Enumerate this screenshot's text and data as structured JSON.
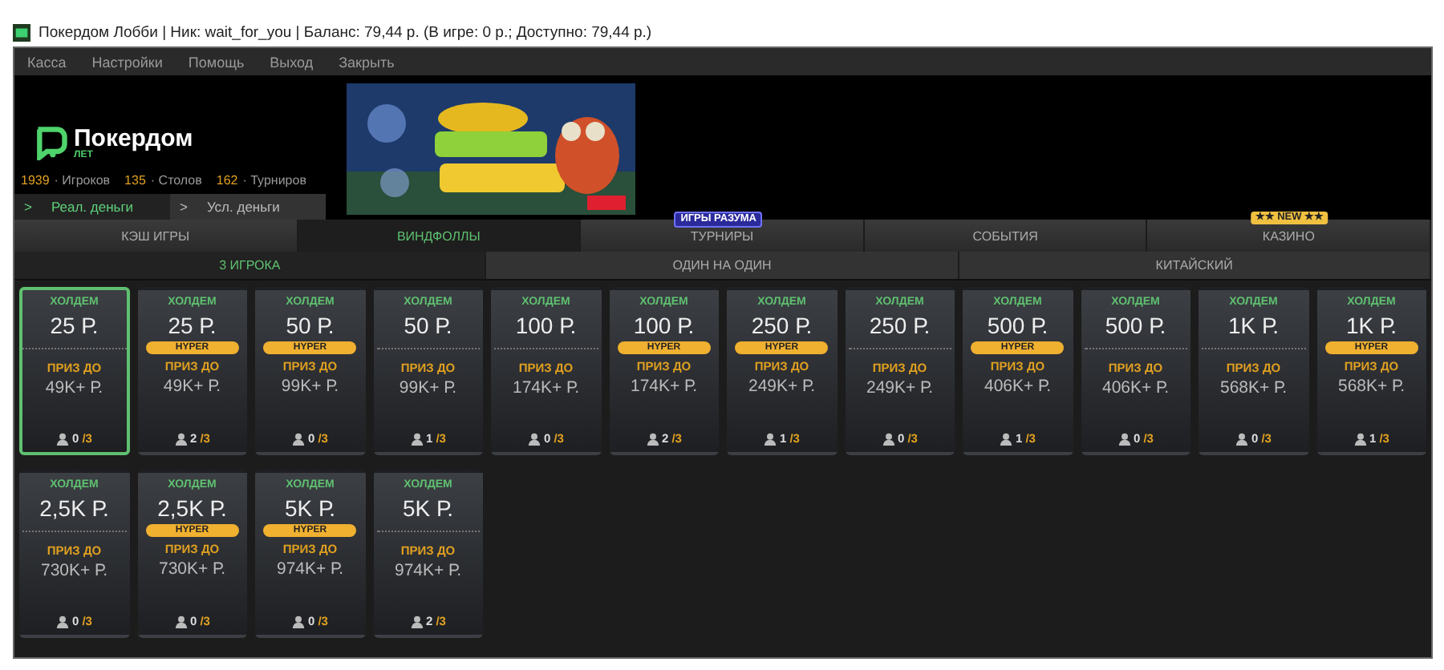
{
  "window": {
    "title": "Покердом Лобби | Ник: wait_for_you | Баланс: 79,44 р. (В игре: 0 р.; Доступно: 79,44 р.)"
  },
  "menu": [
    "Касса",
    "Настройки",
    "Помощь",
    "Выход",
    "Закрыть"
  ],
  "header": {
    "logo": {
      "name": "Покердом",
      "sub": "ЛЕТ"
    },
    "stats": [
      {
        "count": "1939",
        "label": "· Игроков"
      },
      {
        "count": "135",
        "label": "· Столов"
      },
      {
        "count": "162",
        "label": "· Турниров"
      }
    ],
    "money_tabs": [
      {
        "arrow": ">",
        "label": "Реал. деньги",
        "selected": true
      },
      {
        "arrow": ">",
        "label": "Усл. деньги",
        "selected": false
      }
    ]
  },
  "tabs": [
    {
      "label": "КЭШ ИГРЫ",
      "selected": false
    },
    {
      "label": "ВИНДФОЛЛЫ",
      "selected": true
    },
    {
      "label": "ТУРНИРЫ",
      "selected": false,
      "badge": "ИГРЫ РАЗУМА",
      "kind": "mind"
    },
    {
      "label": "СОБЫТИЯ",
      "selected": false
    },
    {
      "label": "КАЗИНО",
      "selected": false,
      "badge": "★★ NEW ★★",
      "kind": "new"
    }
  ],
  "subtabs": [
    {
      "label": "3 ИГРОКА",
      "selected": true
    },
    {
      "label": "ОДИН НА ОДИН",
      "selected": false
    },
    {
      "label": "КИТАЙСКИЙ",
      "selected": false
    }
  ],
  "cards": [
    {
      "game": "ХОЛДЕМ",
      "stake": "25 Р.",
      "prize_label": "ПРИЗ ДО",
      "prize": "49K+ Р.",
      "seated": "0",
      "max": "/3",
      "selected": true
    },
    {
      "game": "ХОЛДЕМ",
      "stake": "25 Р.",
      "badge": "HYPER",
      "prize_label": "ПРИЗ ДО",
      "prize": "49K+ Р.",
      "seated": "2",
      "max": "/3",
      "selected": false
    },
    {
      "game": "ХОЛДЕМ",
      "stake": "50 Р.",
      "badge": "HYPER",
      "prize_label": "ПРИЗ ДО",
      "prize": "99K+ Р.",
      "seated": "0",
      "max": "/3",
      "selected": false
    },
    {
      "game": "ХОЛДЕМ",
      "stake": "50 Р.",
      "prize_label": "ПРИЗ ДО",
      "prize": "99K+ Р.",
      "seated": "1",
      "max": "/3",
      "selected": false
    },
    {
      "game": "ХОЛДЕМ",
      "stake": "100 Р.",
      "prize_label": "ПРИЗ ДО",
      "prize": "174K+ Р.",
      "seated": "0",
      "max": "/3",
      "selected": false
    },
    {
      "game": "ХОЛДЕМ",
      "stake": "100 Р.",
      "badge": "HYPER",
      "prize_label": "ПРИЗ ДО",
      "prize": "174K+ Р.",
      "seated": "2",
      "max": "/3",
      "selected": false
    },
    {
      "game": "ХОЛДЕМ",
      "stake": "250 Р.",
      "badge": "HYPER",
      "prize_label": "ПРИЗ ДО",
      "prize": "249K+ Р.",
      "seated": "1",
      "max": "/3",
      "selected": false
    },
    {
      "game": "ХОЛДЕМ",
      "stake": "250 Р.",
      "prize_label": "ПРИЗ ДО",
      "prize": "249K+ Р.",
      "seated": "0",
      "max": "/3",
      "selected": false
    },
    {
      "game": "ХОЛДЕМ",
      "stake": "500 Р.",
      "badge": "HYPER",
      "prize_label": "ПРИЗ ДО",
      "prize": "406K+ Р.",
      "seated": "1",
      "max": "/3",
      "selected": false
    },
    {
      "game": "ХОЛДЕМ",
      "stake": "500 Р.",
      "prize_label": "ПРИЗ ДО",
      "prize": "406K+ Р.",
      "seated": "0",
      "max": "/3",
      "selected": false
    },
    {
      "game": "ХОЛДЕМ",
      "stake": "1K Р.",
      "prize_label": "ПРИЗ ДО",
      "prize": "568K+ Р.",
      "seated": "0",
      "max": "/3",
      "selected": false
    },
    {
      "game": "ХОЛДЕМ",
      "stake": "1K Р.",
      "badge": "HYPER",
      "prize_label": "ПРИЗ ДО",
      "prize": "568K+ Р.",
      "seated": "1",
      "max": "/3",
      "selected": false
    },
    {
      "game": "ХОЛДЕМ",
      "stake": "2,5K Р.",
      "prize_label": "ПРИЗ ДО",
      "prize": "730K+ Р.",
      "seated": "0",
      "max": "/3",
      "selected": false
    },
    {
      "game": "ХОЛДЕМ",
      "stake": "2,5K Р.",
      "badge": "HYPER",
      "prize_label": "ПРИЗ ДО",
      "prize": "730K+ Р.",
      "seated": "0",
      "max": "/3",
      "selected": false
    },
    {
      "game": "ХОЛДЕМ",
      "stake": "5K Р.",
      "badge": "HYPER",
      "prize_label": "ПРИЗ ДО",
      "prize": "974K+ Р.",
      "seated": "0",
      "max": "/3",
      "selected": false
    },
    {
      "game": "ХОЛДЕМ",
      "stake": "5K Р.",
      "prize_label": "ПРИЗ ДО",
      "prize": "974K+ Р.",
      "seated": "2",
      "max": "/3",
      "selected": false
    }
  ]
}
